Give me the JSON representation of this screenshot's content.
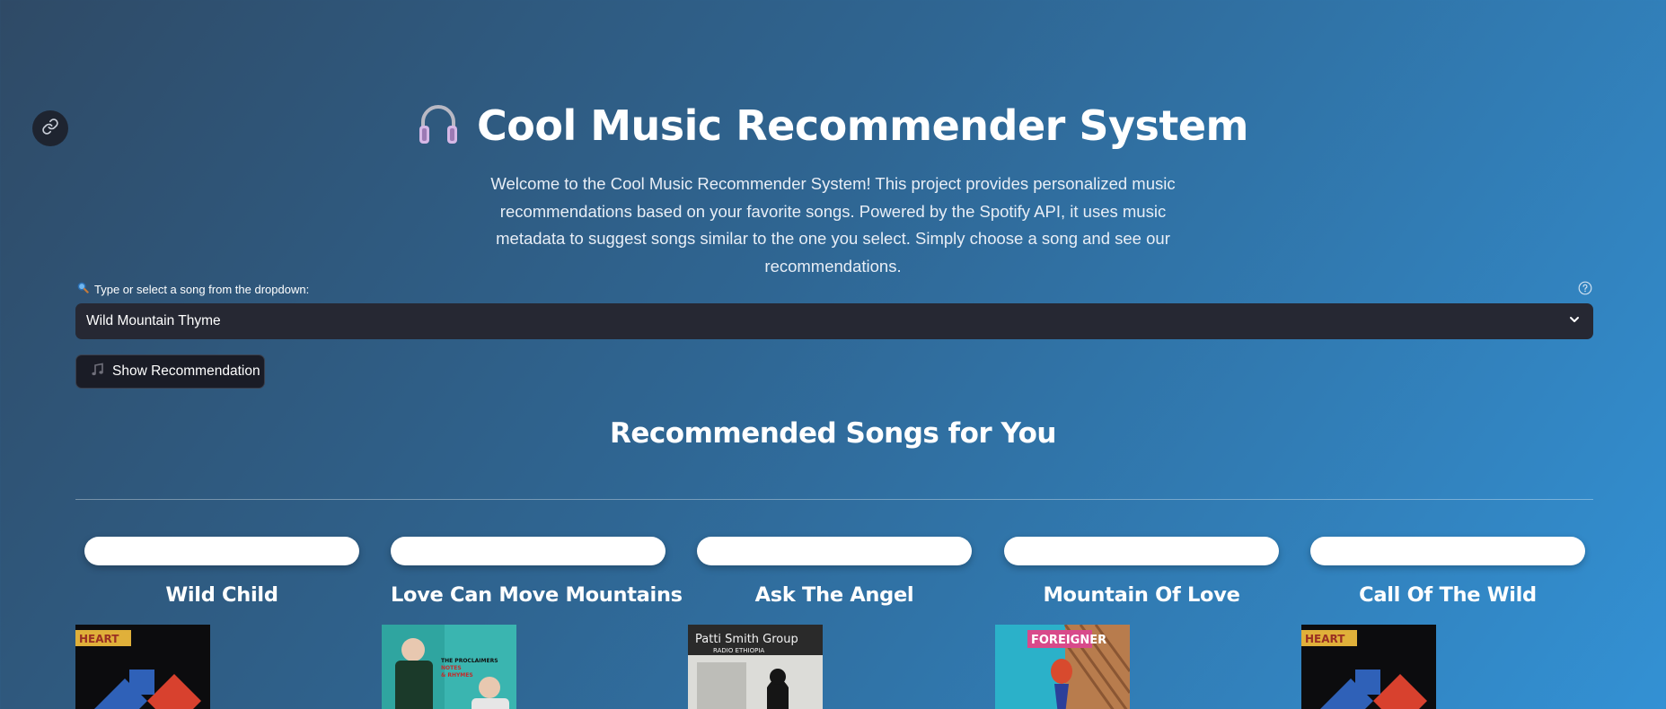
{
  "header": {
    "icon": "headphones-icon",
    "title": "Cool Music Recommender System",
    "intro": "Welcome to the Cool Music Recommender System! This project provides personalized music recommendations based on your favorite songs. Powered by the Spotify API, it uses music metadata to suggest songs similar to the one you select. Simply choose a song and see our recommendations."
  },
  "selector": {
    "label": "Type or select a song from the dropdown:",
    "label_icon": "magnifier-icon",
    "value": "Wild Mountain Thyme",
    "help_icon": "question-circle-icon"
  },
  "recommend_button": {
    "label": "Show Recommendation",
    "icon": "music-notes-icon"
  },
  "results": {
    "heading": "Recommended Songs for You",
    "songs": [
      {
        "title": "Wild Child",
        "cover_text": "HEART"
      },
      {
        "title": "Love Can Move Mountains",
        "cover_text": "THE PROCLAIMERS NOTES & RHYMES"
      },
      {
        "title": "Ask The Angel",
        "cover_text": "Patti Smith Group RADIO ETHIOPIA"
      },
      {
        "title": "Mountain Of Love",
        "cover_text": "FOREIGNER"
      },
      {
        "title": "Call Of The Wild",
        "cover_text": "HEART"
      }
    ]
  },
  "colors": {
    "background_start": "#2f4a66",
    "background_end": "#3391d4",
    "select_bg": "#262833",
    "button_bg": "#1a1c26"
  }
}
